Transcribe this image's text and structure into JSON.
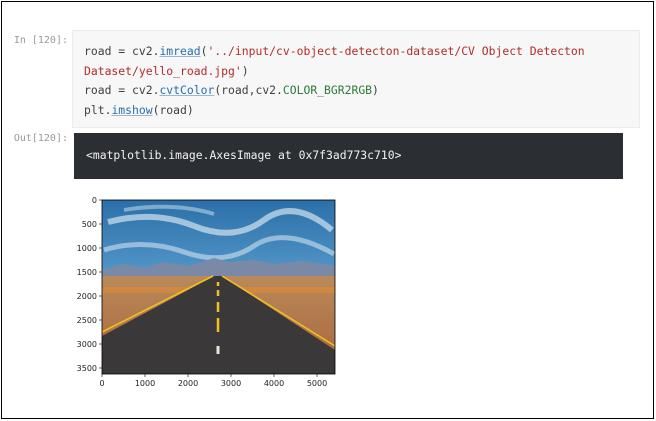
{
  "cell": {
    "in_prompt": "In [120]:",
    "out_prompt": "Out[120]:",
    "code": {
      "line1_a": "road = cv2.",
      "line1_fn": "imread",
      "line1_b": "(",
      "line1_str": "'../input/cv-object-detecton-dataset/CV Object Detecton Dataset/yello_road.jpg'",
      "line1_c": ")",
      "line2_a": "road = cv2.",
      "line2_fn": "cvtColor",
      "line2_b": "(road,cv2.",
      "line2_const": "COLOR_BGR2RGB",
      "line2_c": ")",
      "line3_a": "plt.",
      "line3_fn": "imshow",
      "line3_b": "(road)"
    },
    "output_text": "<matplotlib.image.AxesImage at 0x7f3ad773c710>"
  },
  "plot": {
    "x_ticks": [
      "0",
      "1000",
      "2000",
      "3000",
      "4000",
      "5000"
    ],
    "y_ticks": [
      "0",
      "500",
      "1000",
      "1500",
      "2000",
      "2500",
      "3000",
      "3500"
    ],
    "image_subject": "desert road with yellow center line",
    "colors": {
      "sky_top": "#2a6fa8",
      "sky_bottom": "#8ec3e0",
      "road": "#3a3838",
      "lines": "#f0c020",
      "desert": "#c9793a"
    }
  }
}
